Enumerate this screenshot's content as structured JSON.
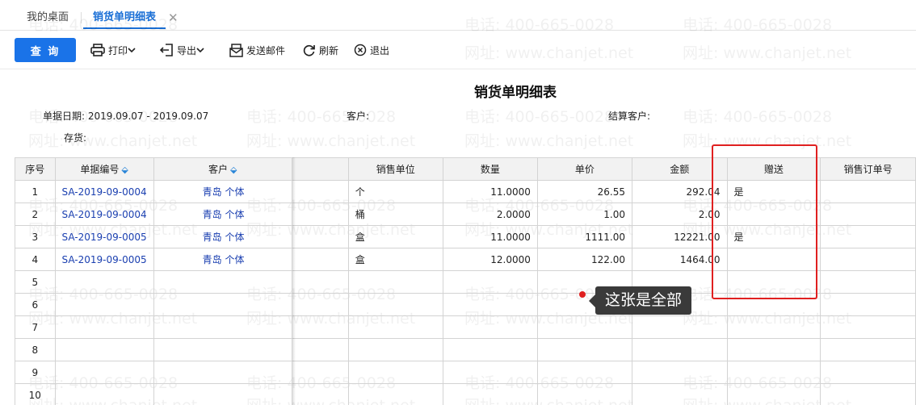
{
  "tabs": {
    "home": "我的桌面",
    "active": "销货单明细表",
    "close": "✕"
  },
  "toolbar": {
    "query": "查 询",
    "print": "打印",
    "export": "导出",
    "mail": "发送邮件",
    "refresh": "刷新",
    "exit": "退出"
  },
  "report": {
    "title": "销货单明细表",
    "date_label": "单据日期: 2019.09.07 - 2019.09.07",
    "customer_label": "客户:",
    "settle_label": "结算客户:",
    "stock_label": "存货:"
  },
  "table": {
    "headers": [
      "序号",
      "单据编号",
      "客户",
      "",
      "销售单位",
      "数量",
      "单价",
      "金额",
      "赠送",
      "销售订单号"
    ],
    "rows": [
      {
        "no": "1",
        "code": "SA-2019-09-0004",
        "customer": "青岛 个体",
        "unit": "个",
        "qty": "11.0000",
        "price": "26.55",
        "amount": "292.04",
        "gift": "是",
        "order": ""
      },
      {
        "no": "2",
        "code": "SA-2019-09-0004",
        "customer": "青岛 个体",
        "unit": "桶",
        "qty": "2.0000",
        "price": "1.00",
        "amount": "2.00",
        "gift": "",
        "order": ""
      },
      {
        "no": "3",
        "code": "SA-2019-09-0005",
        "customer": "青岛 个体",
        "unit": "盒",
        "qty": "11.0000",
        "price": "1111.00",
        "amount": "12221.00",
        "gift": "是",
        "order": ""
      },
      {
        "no": "4",
        "code": "SA-2019-09-0005",
        "customer": "青岛 个体",
        "unit": "盒",
        "qty": "12.0000",
        "price": "122.00",
        "amount": "1464.00",
        "gift": "",
        "order": ""
      },
      {
        "no": "5",
        "code": "",
        "customer": "",
        "unit": "",
        "qty": "",
        "price": "",
        "amount": "",
        "gift": "",
        "order": ""
      },
      {
        "no": "6",
        "code": "",
        "customer": "",
        "unit": "",
        "qty": "",
        "price": "",
        "amount": "",
        "gift": "",
        "order": ""
      },
      {
        "no": "7",
        "code": "",
        "customer": "",
        "unit": "",
        "qty": "",
        "price": "",
        "amount": "",
        "gift": "",
        "order": ""
      },
      {
        "no": "8",
        "code": "",
        "customer": "",
        "unit": "",
        "qty": "",
        "price": "",
        "amount": "",
        "gift": "",
        "order": ""
      },
      {
        "no": "9",
        "code": "",
        "customer": "",
        "unit": "",
        "qty": "",
        "price": "",
        "amount": "",
        "gift": "",
        "order": ""
      },
      {
        "no": "10",
        "code": "",
        "customer": "",
        "unit": "",
        "qty": "",
        "price": "",
        "amount": "",
        "gift": "",
        "order": ""
      }
    ]
  },
  "watermark": {
    "phone": "电话: 400-665-0028",
    "site": "网址: www.chanjet.net"
  },
  "annotation": {
    "callout": "这张是全部"
  },
  "colors": {
    "accent": "#1a73e8",
    "link": "#1a3fb0",
    "highlight": "#e02020"
  }
}
